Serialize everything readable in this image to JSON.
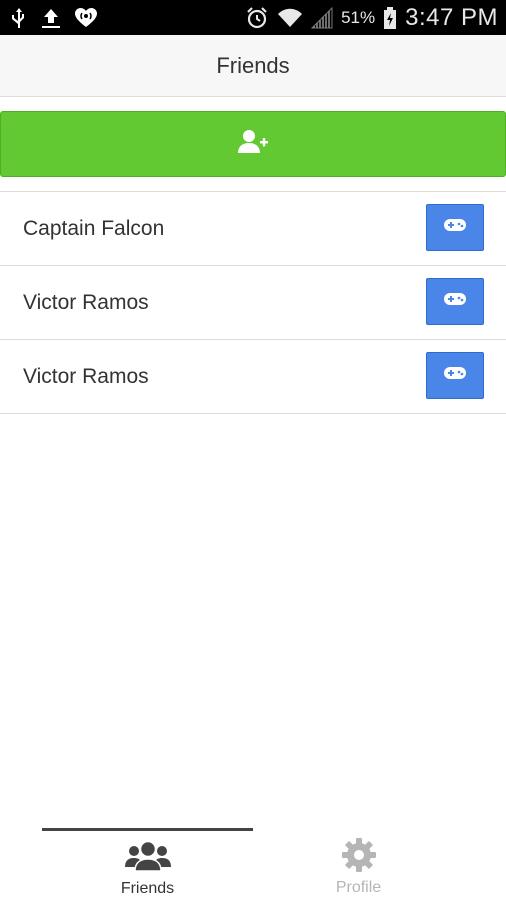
{
  "status_bar": {
    "battery_percent": "51%",
    "time": "3:47 PM",
    "icons": [
      "usb-icon",
      "upload-icon",
      "iheart-icon",
      "alarm-icon",
      "wifi-icon",
      "signal-icon",
      "battery-charging-icon"
    ]
  },
  "header": {
    "title": "Friends"
  },
  "add_friend": {
    "icon": "add-user-icon",
    "color": "#62c932"
  },
  "friends": [
    {
      "name": "Captain Falcon",
      "action_icon": "gamepad-icon"
    },
    {
      "name": "Victor Ramos",
      "action_icon": "gamepad-icon"
    },
    {
      "name": "Victor Ramos",
      "action_icon": "gamepad-icon"
    }
  ],
  "tabs": [
    {
      "label": "Friends",
      "icon": "friends-group-icon",
      "active": true
    },
    {
      "label": "Profile",
      "icon": "gear-icon",
      "active": false
    }
  ],
  "colors": {
    "accent_green": "#62c932",
    "button_blue": "#4a86e8",
    "active_tab": "#333333",
    "inactive_tab": "#b5b5b5"
  }
}
